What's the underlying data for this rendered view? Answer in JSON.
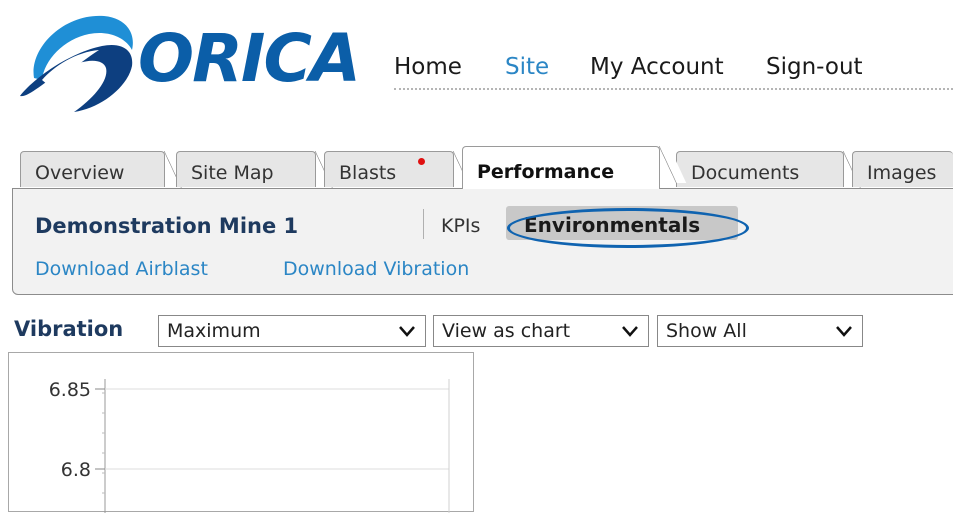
{
  "brand": {
    "name": "ORICA",
    "colors": {
      "blue": "#0b5ea8",
      "dark_blue": "#0d3f80"
    }
  },
  "topnav": {
    "items": [
      {
        "label": "Home",
        "active": false
      },
      {
        "label": "Site",
        "active": true
      },
      {
        "label": "My Account",
        "active": false
      },
      {
        "label": "Sign-out",
        "active": false
      }
    ]
  },
  "tabs": [
    {
      "label": "Overview",
      "active": false
    },
    {
      "label": "Site Map",
      "active": false
    },
    {
      "label": "Blasts",
      "active": false,
      "notification": true
    },
    {
      "label": "Performance",
      "active": true
    },
    {
      "label": "Documents",
      "active": false
    },
    {
      "label": "Images",
      "active": false
    }
  ],
  "panel": {
    "site_name": "Demonstration Mine 1",
    "subtabs": [
      {
        "label": "KPIs",
        "active": false
      },
      {
        "label": "Environmentals",
        "active": true,
        "highlighted": true
      }
    ],
    "links": [
      "Download Airblast",
      "Download Vibration"
    ]
  },
  "controls": {
    "title": "Vibration",
    "metric_select": {
      "value": "Maximum"
    },
    "view_select": {
      "value": "View as chart"
    },
    "filter_select": {
      "value": "Show All"
    }
  },
  "chart_data": {
    "type": "line",
    "yticks": [
      "6.85",
      "6.8"
    ],
    "ylim": [
      6.78,
      6.86
    ],
    "grid": true,
    "series": []
  },
  "colors": {
    "link": "#2b86c5",
    "highlight_ring": "#0f63b0",
    "notification_dot": "#e01010"
  }
}
